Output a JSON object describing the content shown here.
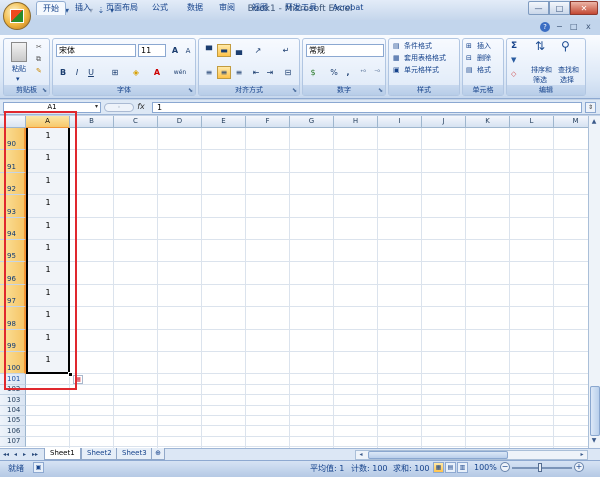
{
  "window": {
    "title": "Book1 - Microsoft Excel"
  },
  "qat": {
    "undo": "↶",
    "undo_drop": "▾",
    "redo": "↷",
    "redo_drop": "▾",
    "customize": "▾",
    "arrow": "⇣"
  },
  "controls": {
    "minimize": "—",
    "maximize": "□",
    "close": "✕",
    "help": "?",
    "rib_min": "−",
    "rib_restore": "□",
    "rib_close": "x"
  },
  "tabs": [
    "开始",
    "插入",
    "页面布局",
    "公式",
    "数据",
    "审阅",
    "视图",
    "开发工具",
    "Acrobat"
  ],
  "ribbon": {
    "clipboard": {
      "label": "剪贴板",
      "paste": "粘贴",
      "paste_drop": "▾"
    },
    "font": {
      "label": "字体",
      "name": "宋体",
      "size": "11",
      "grow": "A",
      "shrink": "A",
      "bold": "B",
      "italic": "I",
      "underline": "U",
      "wen": "wén"
    },
    "alignment": {
      "label": "对齐方式"
    },
    "number": {
      "label": "数字",
      "format": "常规",
      "percent": "%",
      "comma": ","
    },
    "styles": {
      "label": "样式",
      "conditional": "条件格式",
      "table": "套用表格格式",
      "cell": "单元格样式"
    },
    "cells": {
      "label": "单元格",
      "insert": "插入",
      "delete": "删除",
      "format": "格式"
    },
    "editing": {
      "label": "编辑",
      "sort": "排序和",
      "filter": "筛选",
      "find": "查找和",
      "select": "选择",
      "sigma": "Σ"
    }
  },
  "formula_bar": {
    "name_box": "A1",
    "fx": "fx",
    "value": "1"
  },
  "grid": {
    "columns": [
      "A",
      "B",
      "C",
      "D",
      "E",
      "F",
      "G",
      "H",
      "I",
      "J",
      "K",
      "L",
      "M"
    ],
    "rows": [
      "90",
      "91",
      "92",
      "93",
      "94",
      "95",
      "96",
      "97",
      "98",
      "99",
      "100",
      "101",
      "102",
      "103",
      "104",
      "105",
      "106",
      "107"
    ],
    "column_a_values": [
      "1",
      "1",
      "1",
      "1",
      "1",
      "1",
      "1",
      "1",
      "1",
      "1",
      "1"
    ]
  },
  "sheets": [
    "Sheet1",
    "Sheet2",
    "Sheet3"
  ],
  "sheet_nav": [
    "◂◂",
    "◂",
    "▸",
    "▸▸"
  ],
  "status": {
    "ready": "就绪",
    "average": "平均值: 1",
    "count": "计数: 100",
    "sum": "求和: 100",
    "zoom": "100%",
    "zoom_out": "−",
    "zoom_in": "+"
  },
  "colors": {
    "accent": "#15428b",
    "selection_header": "#f7c86a",
    "highlight_box": "#e0282e"
  }
}
